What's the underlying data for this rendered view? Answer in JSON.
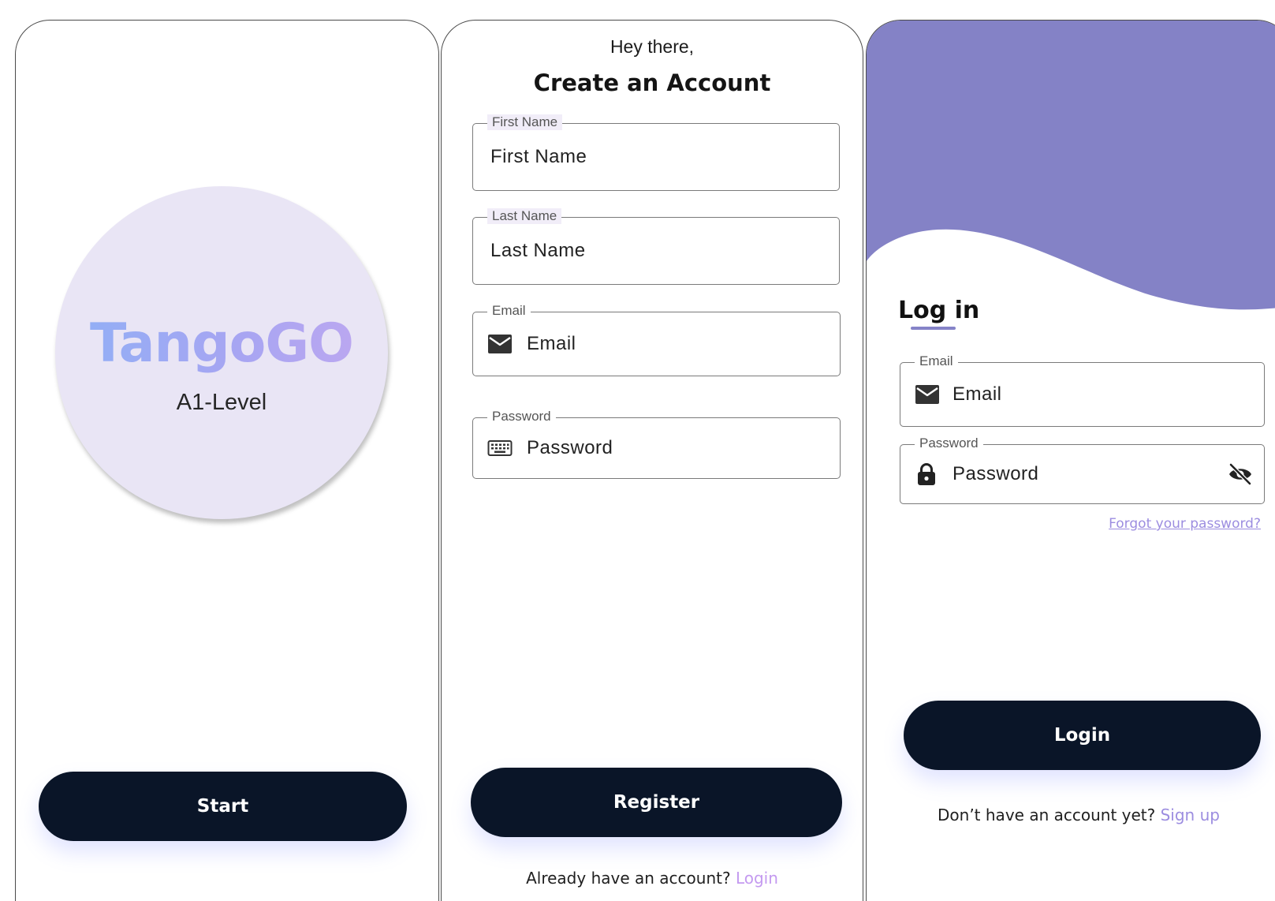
{
  "start_screen": {
    "logo_title": "TangoGO",
    "logo_subtitle": "A1-Level",
    "start_button": "Start"
  },
  "register_screen": {
    "greeting": "Hey there,",
    "title": "Create an Account",
    "first_name": {
      "label": "First Name",
      "value": "First Name"
    },
    "last_name": {
      "label": "Last Name",
      "value": "Last Name"
    },
    "email": {
      "label": "Email",
      "value": "Email",
      "icon": "mail-icon"
    },
    "password": {
      "label": "Password",
      "value": "Password",
      "icon": "keyboard-icon"
    },
    "register_button": "Register",
    "footer_text": "Already have an account?",
    "footer_link": "Login"
  },
  "login_screen": {
    "title": "Log in",
    "email": {
      "label": "Email",
      "value": "Email",
      "icon": "mail-icon"
    },
    "password": {
      "label": "Password",
      "value": "Password",
      "icon": "lock-icon",
      "toggle_icon": "eye-off-icon"
    },
    "forgot_link": "Forgot your password?",
    "login_button": "Login",
    "footer_text": "Don’t have an account yet?",
    "footer_link": "Sign up"
  },
  "colors": {
    "primary_button": "#0a1528",
    "wave": "#8482c6",
    "link": "#c49af0",
    "logo_circle": "#e9e5f5",
    "logo_gradient_start": "#8fb0f6",
    "logo_gradient_end": "#c0a8f0"
  }
}
